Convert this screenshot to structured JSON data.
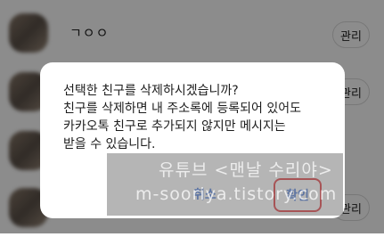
{
  "friend_list": {
    "first_friend_name": "ㄱㅇㅇ",
    "manage_label": "관리"
  },
  "dialog": {
    "message_lines": [
      "선택한 친구를 삭제하시겠습니까?",
      "친구를 삭제하면 내 주소록에 등록되어 있어도",
      "카카오톡 친구로 추가되지 않지만 메시지는",
      "받을 수 있습니다."
    ],
    "cancel_label": "취소",
    "confirm_label": "확인"
  },
  "watermark": {
    "line1": "유튜브 <맨날 수리야>",
    "line2": "m-sooriya.tistory.com"
  },
  "colors": {
    "button_text": "#3b6fd8",
    "highlight_box": "#e0282e",
    "overlay": "rgba(0,0,0,0.45)"
  }
}
